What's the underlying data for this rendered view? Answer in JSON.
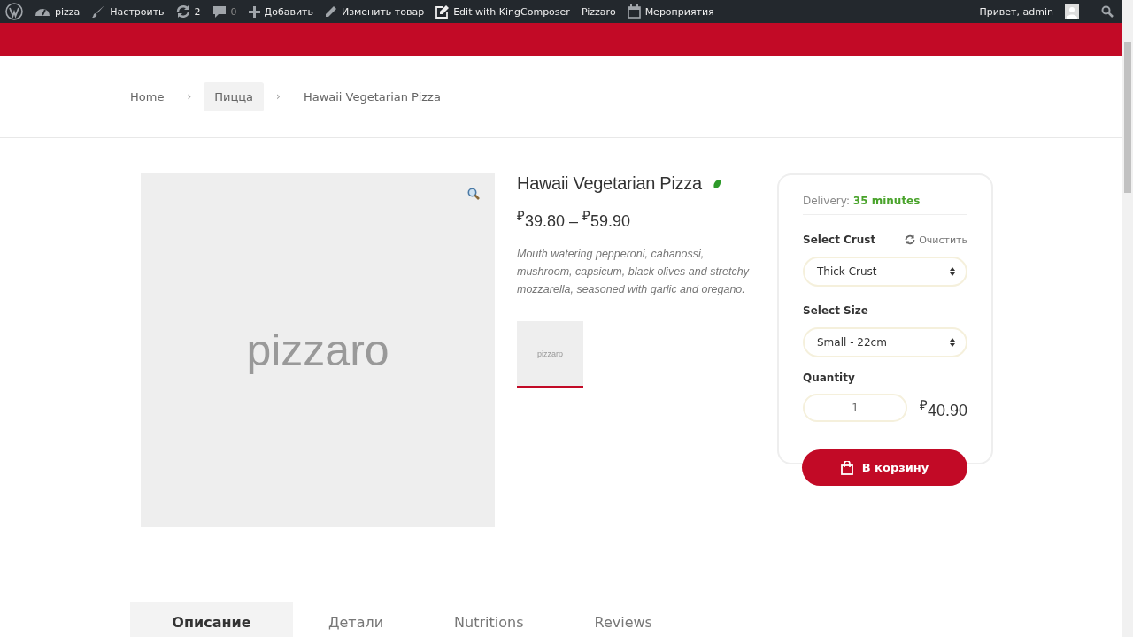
{
  "admin_bar": {
    "items": [
      {
        "kind": "wp"
      },
      {
        "kind": "dashboard",
        "label": "pizza"
      },
      {
        "kind": "brush",
        "label": "Настроить"
      },
      {
        "kind": "updates",
        "label": "2"
      },
      {
        "kind": "comments",
        "label": "0"
      },
      {
        "kind": "add",
        "label": "Добавить"
      },
      {
        "kind": "pencil",
        "label": "Изменить товар"
      },
      {
        "kind": "edit",
        "label": "Edit with KingComposer"
      },
      {
        "kind": "text",
        "label": "Pizzaro"
      },
      {
        "kind": "calendar",
        "label": "Мероприятия"
      }
    ],
    "greeting": "Привет, admin"
  },
  "breadcrumb": [
    {
      "label": "Home",
      "selected": false
    },
    {
      "label": "›",
      "kind": "sep"
    },
    {
      "label": "Пицца",
      "selected": true
    },
    {
      "label": "›",
      "kind": "sep"
    },
    {
      "label": "Hawaii Vegetarian Pizza",
      "selected": false
    }
  ],
  "product": {
    "image_text": "pizzaro",
    "thumbnail_text": "pizzaro",
    "title": "Hawaii Vegetarian Pizza",
    "vegetarian": true,
    "price": "$^{₽}$39.80 – $^{₽}$59.90",
    "description": "Mouth watering pepperoni, cabanossi, mushroom, capsicum, black olives and stretchy mozzarella, seasoned with garlic and oregano."
  },
  "order": {
    "delivery_label": "Delivery:",
    "delivery_time": "35 minutes",
    "crust_label": "Select Crust",
    "clear": "Очистить",
    "crust": "Thick Crust",
    "size_label": "Select Size",
    "size": "Small - 22cm",
    "quantity_label": "Quantity",
    "quantity": "1",
    "total": "$^{₽}$40.90",
    "add_to_cart": "В корзину"
  },
  "tabs": [
    {
      "label": "Описание",
      "selected": true
    },
    {
      "label": "Детали",
      "selected": false
    },
    {
      "label": "Nutritions",
      "selected": false
    },
    {
      "label": "Reviews",
      "selected": false
    }
  ]
}
